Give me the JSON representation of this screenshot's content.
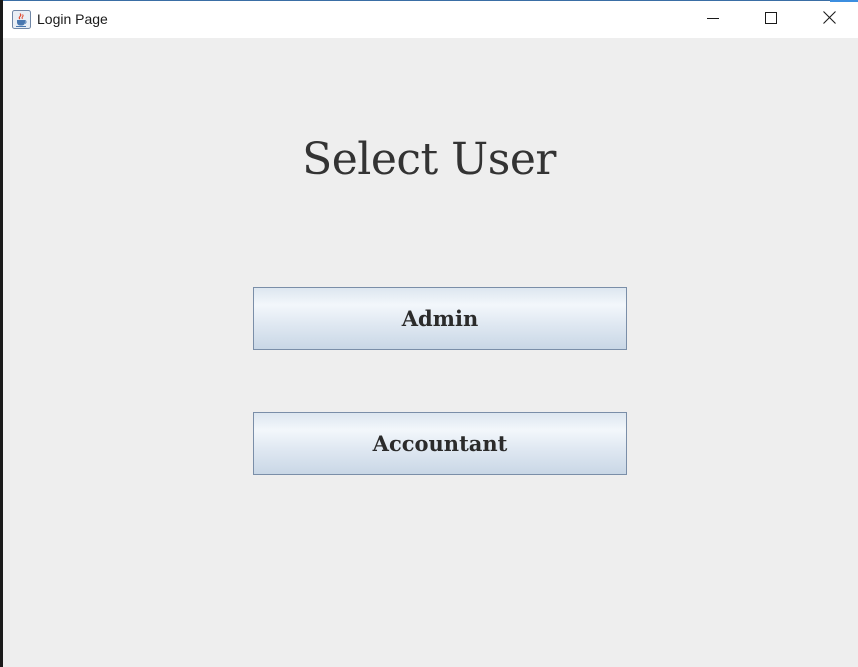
{
  "window": {
    "title": "Login Page",
    "icon": "java-cup-icon",
    "controls": [
      "minimize-icon",
      "maximize-icon",
      "close-icon"
    ]
  },
  "main": {
    "heading": "Select User",
    "buttons": {
      "admin": "Admin",
      "accountant": "Accountant"
    }
  },
  "colors": {
    "background": "#eeeeee",
    "titlebar": "#ffffff",
    "heading_text": "#333333",
    "button_border": "#7a8ea8",
    "button_gradient_light": "#f3f7fb",
    "button_gradient_dark": "#c9d7e6"
  }
}
